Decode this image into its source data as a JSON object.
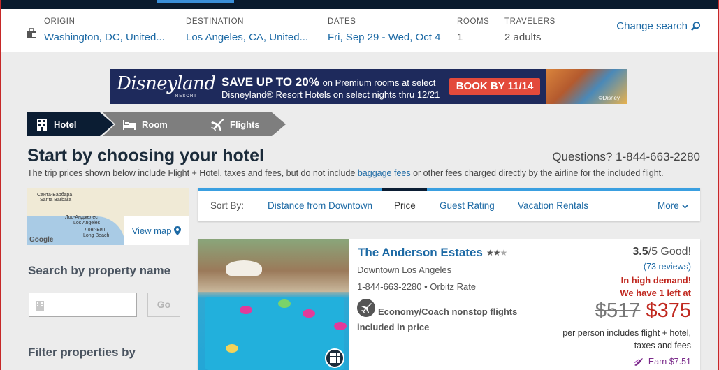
{
  "search": {
    "origin": {
      "label": "ORIGIN",
      "value": "Washington, DC, United..."
    },
    "destination": {
      "label": "DESTINATION",
      "value": "Los Angeles, CA, United..."
    },
    "dates": {
      "label": "DATES",
      "value": "Fri, Sep 29 - Wed, Oct 4"
    },
    "rooms": {
      "label": "ROOMS",
      "value": "1"
    },
    "travelers": {
      "label": "TRAVELERS",
      "value": "2 adults"
    },
    "change_label": "Change search"
  },
  "banner": {
    "logo": "Disneyland",
    "logo_sub": "RESORT",
    "headline_big": "SAVE UP TO 20%",
    "headline_small": "on Premium rooms at select",
    "line2": "Disneyland® Resort Hotels on select nights thru 12/21",
    "cta": "BOOK BY 11/14",
    "credit": "©Disney"
  },
  "steps": [
    {
      "label": "Hotel",
      "active": true
    },
    {
      "label": "Room",
      "active": false
    },
    {
      "label": "Flights",
      "active": false
    }
  ],
  "page": {
    "title": "Start by choosing your hotel",
    "questions": "Questions? 1-844-663-2280",
    "subtitle_before": "The trip prices shown below include Flight + Hotel, taxes and fees, but do not include ",
    "subtitle_link": "baggage fees",
    "subtitle_after": " or other fees charged directly by the airline for the included flight."
  },
  "map": {
    "view_map": "View map",
    "google": "Google",
    "labels": [
      "Санта-Барбара",
      "Santa Barbara",
      "Лос-Анджелес",
      "Los Angeles",
      "Лонг-Бич",
      "Long Beach"
    ]
  },
  "sidebar": {
    "search_heading": "Search by property name",
    "search_placeholder": "",
    "go": "Go",
    "filter_heading": "Filter properties by"
  },
  "sort": {
    "label": "Sort By:",
    "options": [
      "Distance from Downtown",
      "Price",
      "Guest Rating",
      "Vacation Rentals"
    ],
    "active": "Price",
    "more": "More"
  },
  "hotel": {
    "name": "The Anderson Estates",
    "stars": 2.5,
    "location": "Downtown Los Angeles",
    "phone": "1-844-663-2280 • Orbitz Rate",
    "flight_info": "Economy/Coach nonstop flights included in price",
    "rating": "3.5",
    "rating_suffix": "/5 Good!",
    "reviews": "(73 reviews)",
    "demand1": "In high demand!",
    "demand2": "We have 1 left at",
    "old_price": "$517",
    "new_price": "$375",
    "price_note": "per person includes flight + hotel, taxes and fees",
    "earn": "Earn $7.51"
  },
  "colors": {
    "link": "#1d6aa5",
    "accent": "#3a9fe0",
    "alert": "#c0281f",
    "dark_navy": "#0b1d33"
  }
}
